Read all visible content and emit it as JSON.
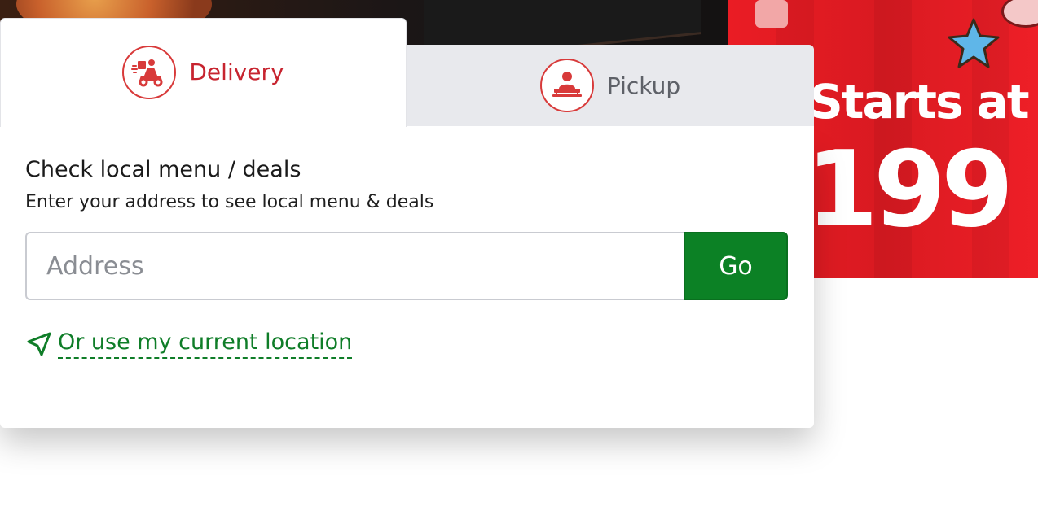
{
  "hero": {
    "promo_headline": "Starts at",
    "promo_price": "199",
    "colors": {
      "promo_red": "#ea1c24",
      "dark": "#141212"
    }
  },
  "order_tabs": [
    {
      "label": "Delivery",
      "icon": "delivery-scooter-icon",
      "active": true
    },
    {
      "label": "Pickup",
      "icon": "pickup-person-icon",
      "active": false
    }
  ],
  "locator": {
    "title": "Check local menu / deals",
    "subtitle": "Enter your address to see local menu & deals",
    "address_placeholder": "Address",
    "address_value": "",
    "go_label": "Go",
    "current_location_label": "Or use my current location",
    "location_icon": "navigation-arrow-icon"
  },
  "colors": {
    "brand_red": "#c7242f",
    "go_green": "#0c8125",
    "link_green": "#0f7d28",
    "tab_inactive_bg": "#e8e9ed"
  }
}
